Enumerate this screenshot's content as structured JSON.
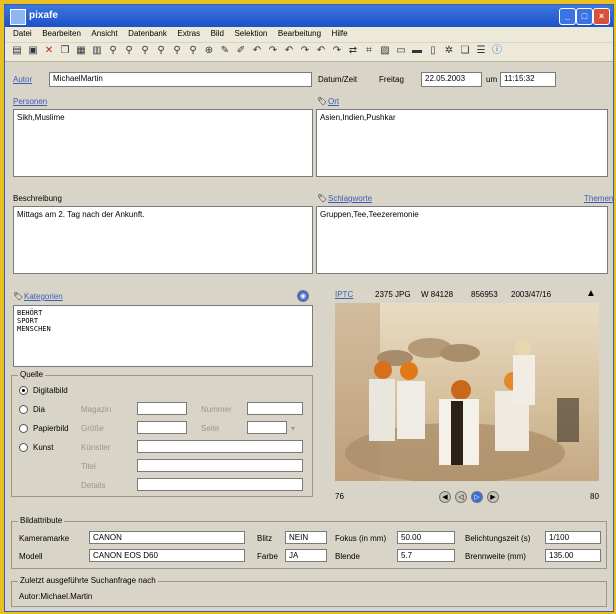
{
  "window": {
    "title": "pixafe"
  },
  "menu": [
    "Datei",
    "Bearbeiten",
    "Ansicht",
    "Datenbank",
    "Extras",
    "Bild",
    "Selektion",
    "Bearbeitung",
    "Hilfe"
  ],
  "form": {
    "autor_label": "Autor",
    "autor_value": "MichaelMartin",
    "datum_label": "Datum/Zeit",
    "wochentag": "Freitag",
    "datum": "22.05.2003",
    "um_label": "um",
    "zeit": "11:15:32",
    "personen_label": "Personen",
    "personen_value": "Sikh,Muslime",
    "ort_label": "Ort",
    "ort_value": "Asien,Indien,Pushkar",
    "beschreibung_label": "Beschreibung",
    "beschreibung_value": "Mittags am 2. Tag nach der Ankunft.",
    "schlagworte_label": "Schlagworte",
    "schlagworte_value": "Gruppen,Tee,Teezeremonie",
    "themen_label": "Themen",
    "kategorien_label": "Kategorien",
    "kategorien_lines": [
      "BEHÖRT",
      "SPORT",
      "MENSCHEN"
    ]
  },
  "quelle": {
    "title": "Quelle",
    "options": [
      "Digitalbild",
      "Dia",
      "Papierbild",
      "Kunst"
    ],
    "fields": [
      "Magazin",
      "Nummer",
      "Größe",
      "Seite",
      "Künstler",
      "Titel",
      "Details"
    ]
  },
  "image": {
    "info": [
      "IPTC",
      "2375 JPG",
      "W 84128",
      "856953",
      "2003/47/16"
    ],
    "left_number": "76",
    "right_number": "80"
  },
  "bildattribute": {
    "title": "Bildattribute",
    "kameramarke_label": "Kameramarke",
    "kameramarke_value": "CANON",
    "modell_label": "Modell",
    "modell_value": "CANON EOS D60",
    "blitz_label": "Blitz",
    "blitz_value": "NEIN",
    "farbe_label": "Farbe",
    "farbe_value": "JA",
    "fokus_label": "Fokus (in mm)",
    "fokus_value": "50.00",
    "blende_label": "Blende",
    "blende_value": "5.7",
    "belichtung_label": "Belichtungszeit (s)",
    "belichtung_value": "1/100",
    "brennweite_label": "Brennweite (mm)",
    "brennweite_value": "135.00"
  },
  "suche": {
    "title": "Zuletzt ausgeführte Suchanfrage nach",
    "value": "Autor:Michael.Martin"
  },
  "colors": {
    "titlebar": "#1c50c8",
    "link": "#3a5fb8",
    "background": "#d9d4c8"
  },
  "icons": [
    "open-icon",
    "save-icon",
    "delete-icon",
    "copy-icon",
    "paste-icon",
    "print-icon",
    "find-icon",
    "zoom-icon",
    "edit-icon",
    "rotate-icon",
    "info-icon"
  ]
}
